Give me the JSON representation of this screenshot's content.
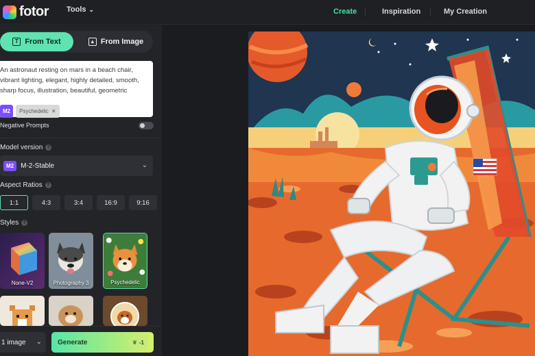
{
  "app": {
    "logo_text": "fotor",
    "tools_label": "Tools"
  },
  "nav": {
    "create": "Create",
    "inspiration": "Inspiration",
    "my_creation": "My Creation"
  },
  "mode_tabs": {
    "from_text": "From Text",
    "from_image": "From Image"
  },
  "prompt": {
    "text": "An astronaut resting on mars in a beach chair, vibrant lighting, elegant, highly detailed, smooth, sharp focus, illustration, beautiful, geometric",
    "model_tag": "M2",
    "style_tag": "Psychedelic"
  },
  "negative_prompts": {
    "label": "Negative Prompts",
    "enabled": false
  },
  "model": {
    "label": "Model version",
    "badge": "M2",
    "name": "M-2-Stable"
  },
  "aspect": {
    "label": "Aspect Ratios",
    "options": [
      "1:1",
      "4:3",
      "3:4",
      "16:9",
      "9:16"
    ],
    "selected": "1:1"
  },
  "styles": {
    "label": "Styles",
    "items": [
      {
        "label": "None-V2",
        "selected": false
      },
      {
        "label": "Photography 3",
        "selected": false
      },
      {
        "label": "Psychedelic",
        "selected": true
      }
    ]
  },
  "bottom": {
    "quantity": "1 image",
    "generate": "Generate",
    "credit": "-1"
  },
  "colors": {
    "accent": "#5fe3b1",
    "purple": "#7c4dff",
    "bg": "#1b1c1f"
  }
}
